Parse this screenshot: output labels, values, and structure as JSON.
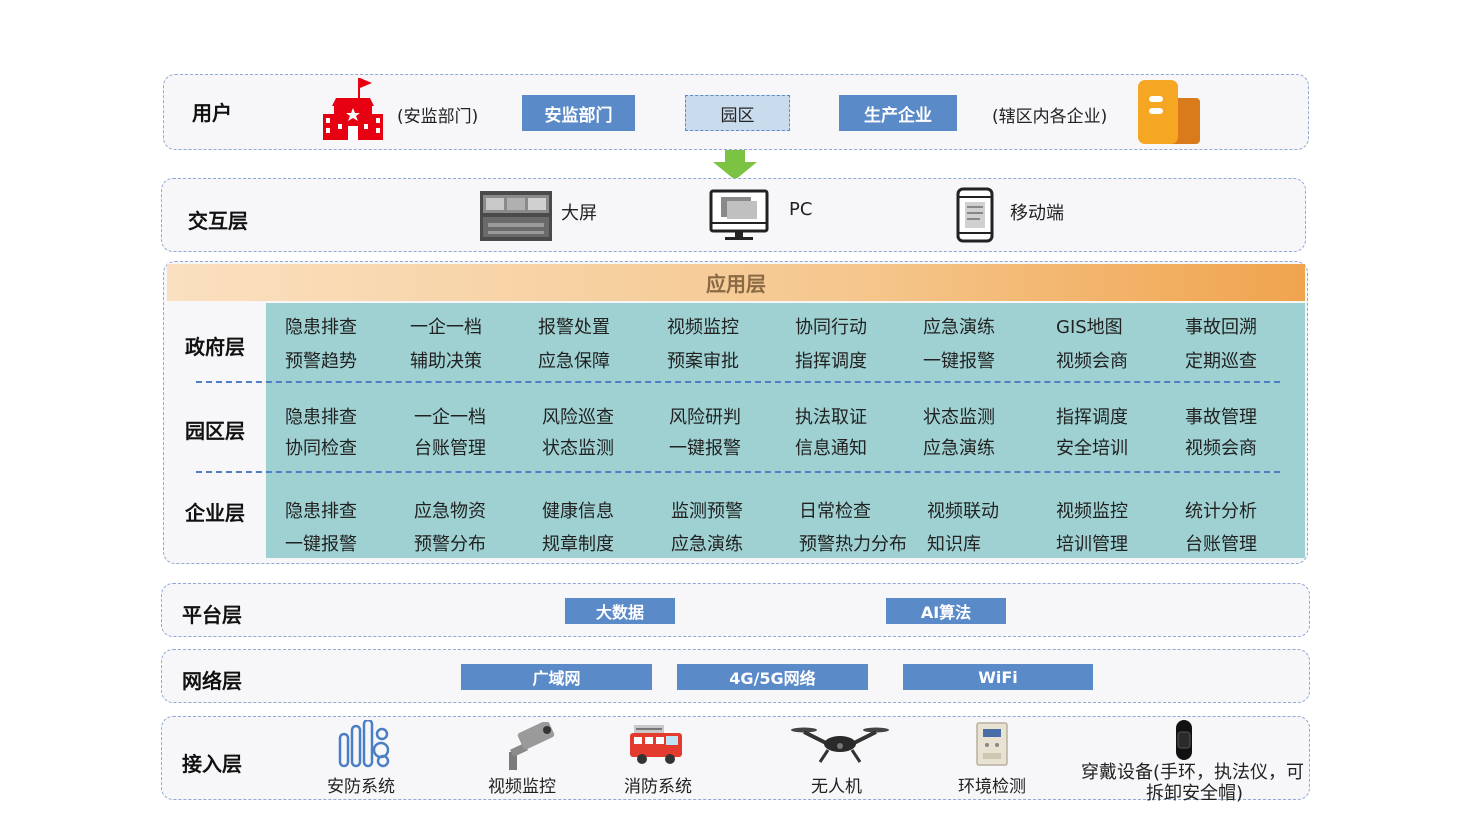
{
  "users": {
    "title": "用户",
    "left_note": "(安监部门)",
    "buttons": [
      "安监部门",
      "园区",
      "生产企业"
    ],
    "right_note": "(辖区内各企业)"
  },
  "interaction": {
    "title": "交互层",
    "items": [
      "大屏",
      "PC",
      "移动端"
    ]
  },
  "application": {
    "title": "应用层",
    "gov": {
      "title": "政府层",
      "row1": [
        "隐患排查",
        "一企一档",
        "报警处置",
        "视频监控",
        "协同行动",
        "应急演练",
        "GIS地图",
        "事故回溯"
      ],
      "row2": [
        "预警趋势",
        "辅助决策",
        "应急保障",
        "预案审批",
        "指挥调度",
        "一键报警",
        "视频会商",
        "定期巡查"
      ]
    },
    "park": {
      "title": "园区层",
      "row1": [
        "隐患排查",
        "一企一档",
        "风险巡查",
        "风险研判",
        "执法取证",
        "状态监测",
        "指挥调度",
        "事故管理"
      ],
      "row2": [
        "协同检查",
        "台账管理",
        "状态监测",
        "一键报警",
        "信息通知",
        "应急演练",
        "安全培训",
        "视频会商"
      ]
    },
    "enterprise": {
      "title": "企业层",
      "row1": [
        "隐患排查",
        "应急物资",
        "健康信息",
        "监测预警",
        "日常检查",
        "视频联动",
        "视频监控",
        "统计分析"
      ],
      "row2": [
        "一键报警",
        "预警分布",
        "规章制度",
        "应急演练",
        "预警热力分布",
        "知识库",
        "培训管理",
        "台账管理"
      ]
    }
  },
  "platform": {
    "title": "平台层",
    "items": [
      "大数据",
      "AI算法"
    ]
  },
  "network": {
    "title": "网络层",
    "items": [
      "广域网",
      "4G/5G网络",
      "WiFi"
    ]
  },
  "access": {
    "title": "接入层",
    "items": [
      "安防系统",
      "视频监控",
      "消防系统",
      "无人机",
      "环境检测"
    ],
    "wearable_line1": "穿戴设备(手环，执法仪，可",
    "wearable_line2": "拆卸安全帽)"
  },
  "colors": {
    "button_blue": "#5b8ac8",
    "grid_teal": "#9fd1d3",
    "header_orange": "#f2b06a",
    "arrow_green": "#7cc243",
    "flag_red": "#e60012",
    "building_orange": "#f5a623"
  },
  "icons": [
    "government-building-icon",
    "enterprise-building-icon",
    "down-arrow-icon",
    "big-screen-icon",
    "pc-monitor-icon",
    "mobile-phone-icon",
    "security-system-icon",
    "cctv-camera-icon",
    "fire-truck-icon",
    "drone-icon",
    "environment-monitor-icon",
    "wristband-icon"
  ]
}
